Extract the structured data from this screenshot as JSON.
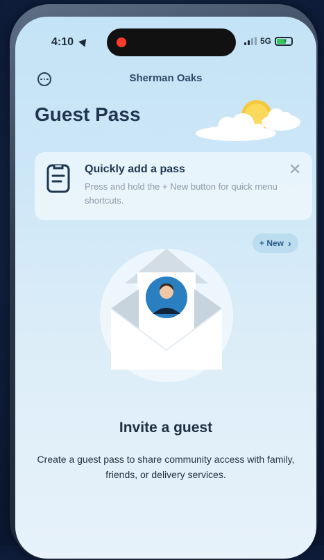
{
  "status_bar": {
    "time": "4:10",
    "network": "5G",
    "battery_percent": 50
  },
  "header": {
    "location": "Sherman Oaks"
  },
  "page": {
    "title": "Guest Pass"
  },
  "tip_card": {
    "title": "Quickly add a pass",
    "description": "Press and hold the + New button for quick menu shortcuts.",
    "close_glyph": "✕"
  },
  "new_button": {
    "label": "+ New",
    "chevron": "›"
  },
  "empty_state": {
    "title": "Invite a guest",
    "description": "Create a guest pass to share community access with family, friends, or delivery services."
  },
  "colors": {
    "accent": "#2a7fc0",
    "title": "#1f3550",
    "battery_fill": "#34c759",
    "recording": "#ff3b30"
  }
}
